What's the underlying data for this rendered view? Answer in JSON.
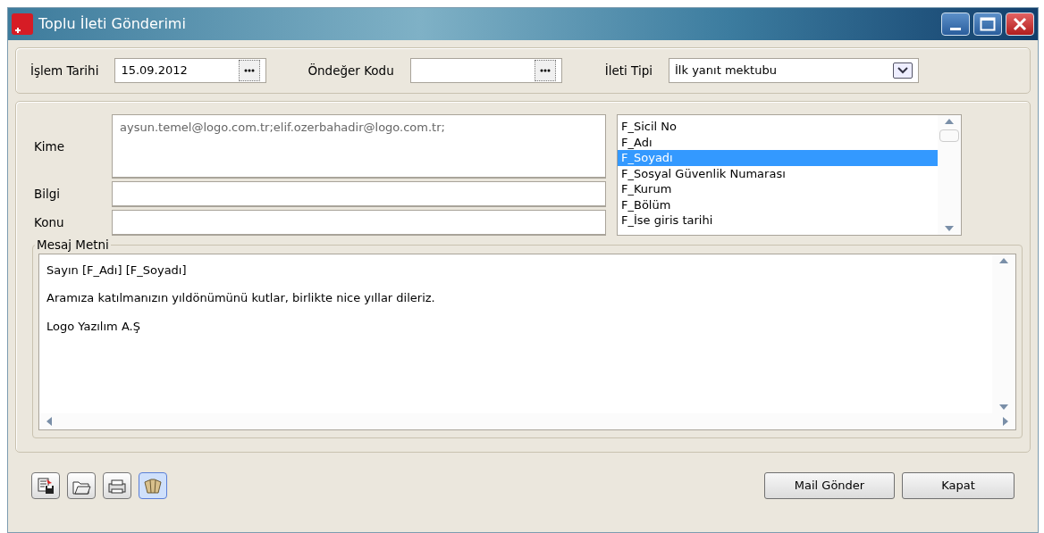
{
  "window": {
    "title": "Toplu İleti Gönderimi"
  },
  "header": {
    "fields": [
      {
        "label": "İşlem Tarihi",
        "value": "15.09.2012",
        "kind": "lookup"
      },
      {
        "label": "Öndeğer Kodu",
        "kind": "lookup"
      },
      {
        "label": "İleti Tipi",
        "value": "İlk yanıt mektubu",
        "kind": "combo"
      }
    ]
  },
  "recipients": [
    {
      "label": "Kime",
      "value": "aysun.temel@logo.com.tr;elif.ozerbahadir@logo.com.tr;",
      "kind": "multi"
    },
    {
      "label": "Bilgi",
      "kind": "single"
    },
    {
      "label": "Konu",
      "kind": "single"
    }
  ],
  "field_list": {
    "items": [
      {
        "label": "F_Sicil No",
        "selected": false
      },
      {
        "label": "F_Adı",
        "selected": false
      },
      {
        "label": "F_Soyadı",
        "selected": true
      },
      {
        "label": "F_Sosyal Güvenlik Numarası",
        "selected": false
      },
      {
        "label": "F_Kurum",
        "selected": false
      },
      {
        "label": "F_Bölüm",
        "selected": false
      },
      {
        "label": "F_İse giris tarihi",
        "selected": false
      }
    ]
  },
  "message": {
    "legend": "Mesaj Metni",
    "lines": [
      "Sayın [F_Adı] [F_Soyadı]",
      "Aramıza katılmanızın yıldönümünü kutlar, birlikte nice yıllar dileriz.",
      "Logo Yazılım A.Ş"
    ]
  },
  "toolbar": [
    {
      "kind": "save",
      "active": false
    },
    {
      "kind": "open",
      "active": false
    },
    {
      "kind": "print",
      "active": false
    },
    {
      "kind": "template",
      "active": true
    }
  ],
  "buttons": [
    {
      "label": "Mail Gönder"
    },
    {
      "label": "Kapat"
    }
  ]
}
